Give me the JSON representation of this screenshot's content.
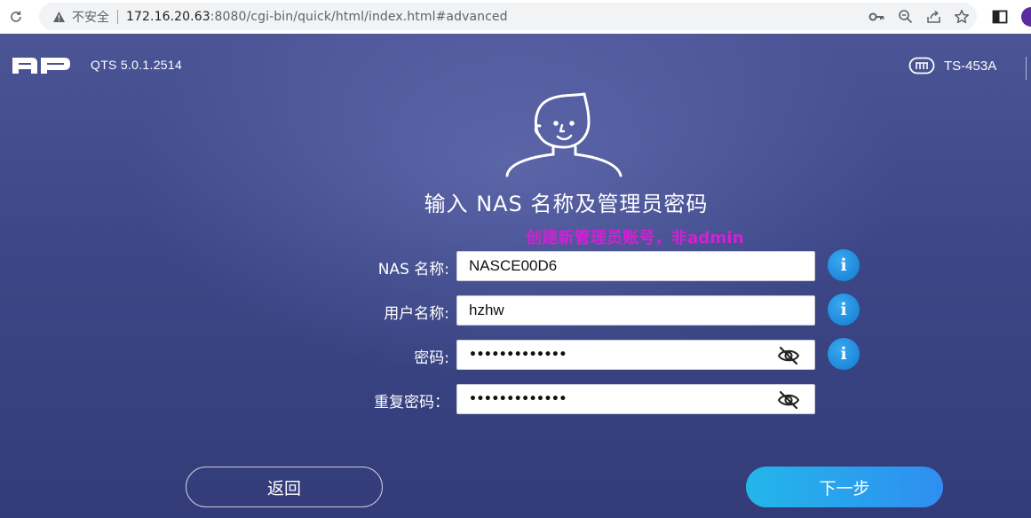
{
  "browser": {
    "security_label": "不安全",
    "url_host": "172.16.20.63",
    "url_rest": ":8080/cgi-bin/quick/html/index.html#advanced",
    "icons": [
      "reload-icon",
      "warning-icon",
      "key-icon",
      "zoom-icon",
      "share-icon",
      "star-icon",
      "side-panel-icon",
      "profile-avatar"
    ]
  },
  "header": {
    "logo_text": "NAP",
    "version": "QTS 5.0.1.2514",
    "device_name": "TS-453A"
  },
  "main": {
    "title": "输入 NAS 名称及管理员密码",
    "annotation": "创建新管理员账号，非admin",
    "fields": [
      {
        "label": "NAS 名称:",
        "value": "NASCE00D6"
      },
      {
        "label": "用户名称:",
        "value": "hzhw"
      },
      {
        "label": "密码:",
        "value": "•••••••••••••"
      },
      {
        "label": "重复密码：",
        "value": "•••••••••••••"
      }
    ],
    "back_label": "返回",
    "next_label": "下一步"
  },
  "colors": {
    "annotation": "#d41fd4",
    "info_button": "#1479cf",
    "next_button": "#2f8ef0"
  }
}
